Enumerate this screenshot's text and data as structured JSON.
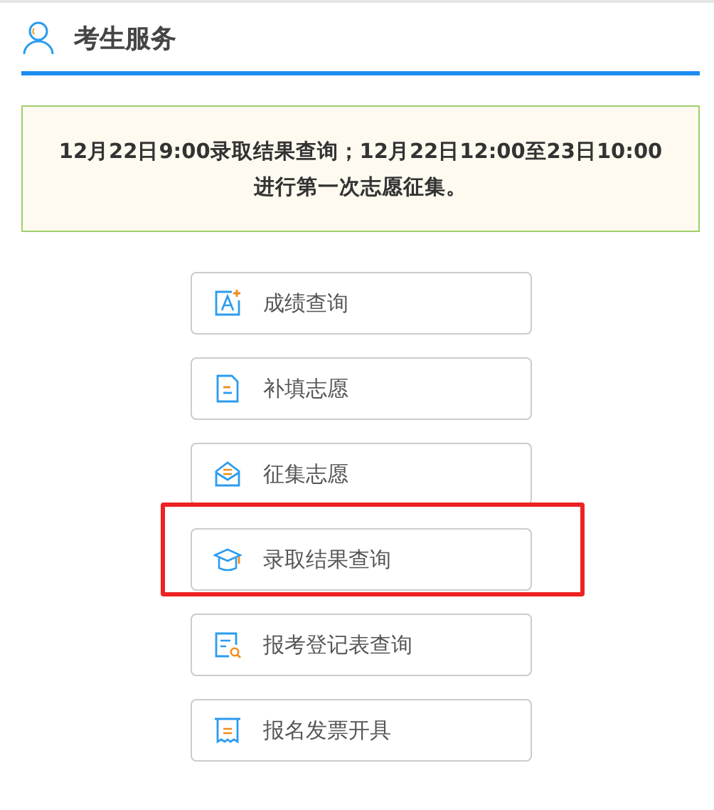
{
  "header": {
    "title": "考生服务"
  },
  "notice": {
    "lines": [
      "12月22日9:00录取结果查询；12月22日12:00至23日10:00",
      "进行第一次志愿征集。"
    ]
  },
  "services": [
    {
      "kind": "score",
      "label": "成绩查询",
      "highlighted": false
    },
    {
      "kind": "form",
      "label": "补填志愿",
      "highlighted": false
    },
    {
      "kind": "mail",
      "label": "征集志愿",
      "highlighted": false
    },
    {
      "kind": "cap",
      "label": "录取结果查询",
      "highlighted": true
    },
    {
      "kind": "search-doc",
      "label": "报考登记表查询",
      "highlighted": false
    },
    {
      "kind": "receipt",
      "label": "报名发票开具",
      "highlighted": false
    }
  ]
}
